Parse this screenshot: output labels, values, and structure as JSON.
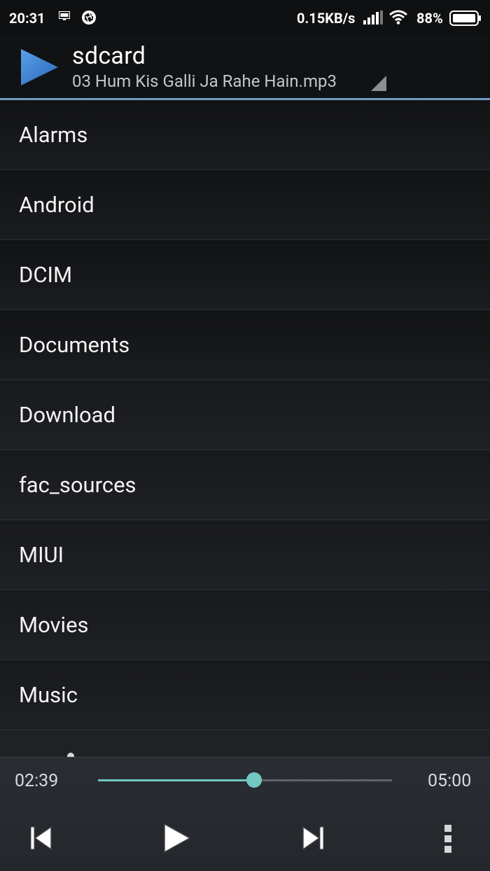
{
  "status_bar": {
    "time": "20:31",
    "network_speed": "0.15KB/s",
    "battery_percent": "88%",
    "icons": [
      "ftp-icon",
      "aperture-icon",
      "signal-icon",
      "wifi-icon",
      "battery-icon"
    ]
  },
  "header": {
    "title": "sdcard",
    "now_playing": "03 Hum Kis Galli Ja Rahe Hain.mp3",
    "accent_color": "#3d7fd1"
  },
  "folders": [
    "Alarms",
    "Android",
    "DCIM",
    "Documents",
    "Download",
    "fac_sources",
    "MIUI",
    "Movies",
    "Music"
  ],
  "player": {
    "current_time": "02:39",
    "total_time": "05:00",
    "progress_fraction": 0.53,
    "accent_color": "#74c8c2",
    "controls": [
      "previous-icon",
      "play-icon",
      "next-icon",
      "more-vert-icon"
    ]
  }
}
